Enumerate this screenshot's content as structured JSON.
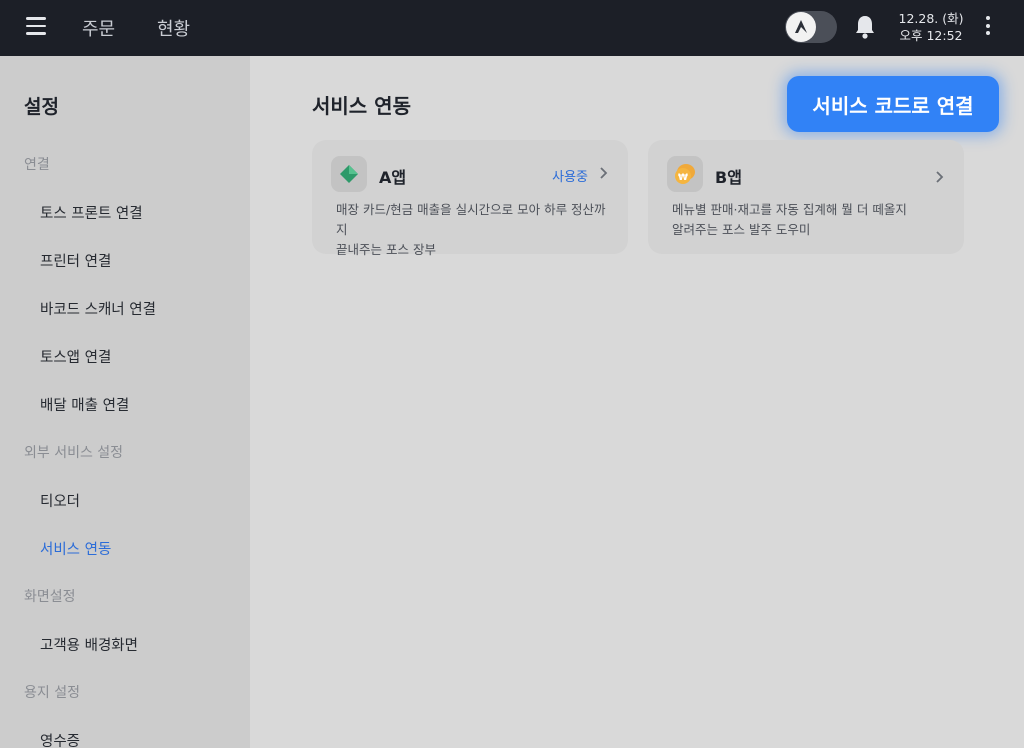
{
  "topbar": {
    "tabs": [
      {
        "label": "주문"
      },
      {
        "label": "현황"
      }
    ],
    "date": "12.28. (화)",
    "time": "오후 12:52"
  },
  "sidebar": {
    "title": "설정",
    "sections": [
      {
        "label": "연결",
        "items": [
          {
            "label": "토스 프론트 연결"
          },
          {
            "label": "프린터 연결"
          },
          {
            "label": "바코드 스캐너 연결"
          },
          {
            "label": "토스앱 연결"
          },
          {
            "label": "배달 매출 연결"
          }
        ]
      },
      {
        "label": "외부 서비스 설정",
        "items": [
          {
            "label": "티오더"
          },
          {
            "label": "서비스 연동"
          }
        ]
      },
      {
        "label": "화면설정",
        "items": [
          {
            "label": "고객용 배경화면"
          }
        ]
      },
      {
        "label": "용지 설정",
        "items": [
          {
            "label": "영수증"
          }
        ]
      }
    ],
    "active_item": "서비스 연동"
  },
  "main": {
    "title": "서비스 연동",
    "connect_button": "서비스 코드로 연결",
    "cards": [
      {
        "name": "A앱",
        "status": "사용중",
        "desc_line1": "매장 카드/현금 매출을 실시간으로 모아 하루 정산까지",
        "desc_line2": "끝내주는 포스 장부",
        "icon": "green-diamond-icon"
      },
      {
        "name": "B앱",
        "status": "",
        "desc_line1": "메뉴별 판매·재고를 자동 집계해 뭘 더 떼올지",
        "desc_line2": "알려주는 포스 발주 도우미",
        "icon": "won-coin-icon"
      }
    ]
  },
  "colors": {
    "accent": "#3182f6",
    "topbar_bg": "#1c1f27",
    "active_link": "#2b6cd8"
  }
}
